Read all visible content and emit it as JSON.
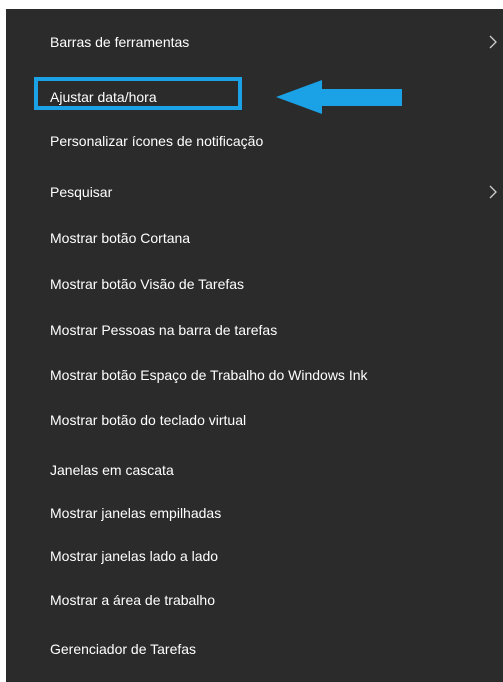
{
  "menu": {
    "background": "#2b2b2b",
    "text_color": "#ffffff",
    "items": [
      {
        "label": "Barras de ferramentas",
        "submenu": true
      },
      {
        "label": "Ajustar data/hora",
        "submenu": false
      },
      {
        "label": "Personalizar ícones de notificação",
        "submenu": false
      },
      {
        "label": "Pesquisar",
        "submenu": true
      },
      {
        "label": "Mostrar botão Cortana",
        "submenu": false
      },
      {
        "label": "Mostrar botão Visão de Tarefas",
        "submenu": false
      },
      {
        "label": "Mostrar Pessoas na barra de tarefas",
        "submenu": false
      },
      {
        "label": "Mostrar botão Espaço de Trabalho do Windows Ink",
        "submenu": false
      },
      {
        "label": "Mostrar botão do teclado virtual",
        "submenu": false
      },
      {
        "label": "Janelas em cascata",
        "submenu": false
      },
      {
        "label": "Mostrar janelas empilhadas",
        "submenu": false
      },
      {
        "label": "Mostrar janelas lado a lado",
        "submenu": false
      },
      {
        "label": "Mostrar a área de trabalho",
        "submenu": false
      },
      {
        "label": "Gerenciador de Tarefas",
        "submenu": false
      }
    ]
  },
  "annotation": {
    "highlight_color": "#1aa1e6",
    "highlighted_item": "Ajustar data/hora",
    "arrow_icon": "arrow-left-icon"
  }
}
